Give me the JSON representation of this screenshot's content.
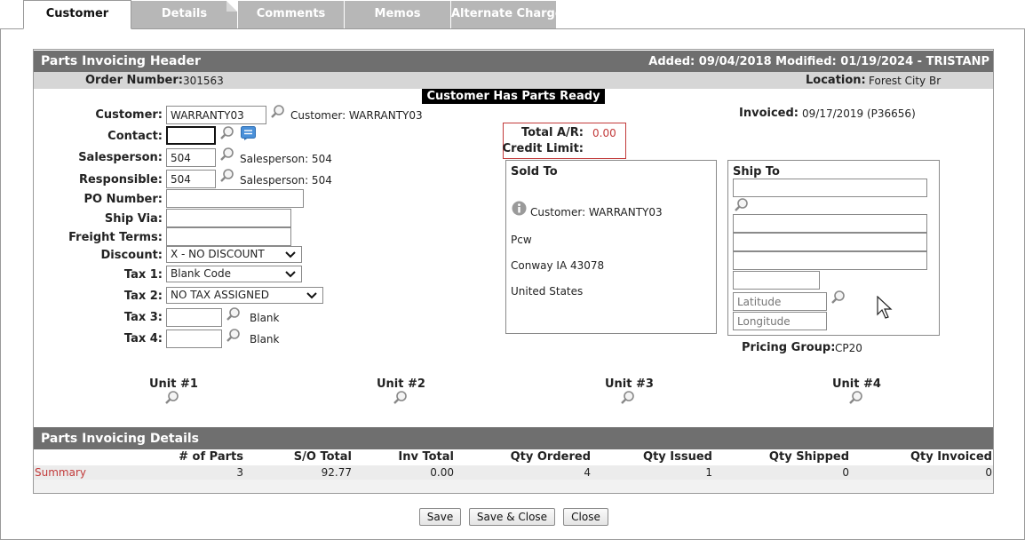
{
  "tabs": [
    "Customer",
    "Details",
    "Comments",
    "Memos",
    "Alternate Charge"
  ],
  "header": {
    "title": "Parts Invoicing Header",
    "added_modified": "Added: 09/04/2018 Modified: 01/19/2024 - TRISTANP",
    "order_number_label": "Order Number:",
    "order_number": "301563",
    "location_label": "Location:",
    "location": "Forest City Br",
    "banner": "Customer Has Parts Ready"
  },
  "form": {
    "customer_label": "Customer:",
    "customer_value": "WARRANTY03",
    "customer_desc": "Customer: WARRANTY03",
    "contact_label": "Contact:",
    "contact_value": "",
    "salesperson_label": "Salesperson:",
    "salesperson_value": "504",
    "salesperson_desc": "Salesperson: 504",
    "responsible_label": "Responsible:",
    "responsible_value": "504",
    "responsible_desc": "Salesperson: 504",
    "po_label": "PO Number:",
    "po_value": "",
    "shipvia_label": "Ship Via:",
    "shipvia_value": "",
    "freight_label": "Freight Terms:",
    "freight_value": "",
    "discount_label": "Discount:",
    "discount_value": "X - NO DISCOUNT",
    "tax1_label": "Tax 1:",
    "tax1_value": "Blank Code",
    "tax2_label": "Tax 2:",
    "tax2_value": "NO TAX ASSIGNED",
    "tax3_label": "Tax 3:",
    "tax3_value": "",
    "tax3_desc": "Blank",
    "tax4_label": "Tax 4:",
    "tax4_value": "",
    "tax4_desc": "Blank"
  },
  "ar": {
    "total_label": "Total A/R:",
    "total_value": "0.00",
    "credit_label": "Credit Limit:",
    "credit_value": ""
  },
  "invoiced": {
    "label": "Invoiced:",
    "value": "09/17/2019 (P36656)"
  },
  "sold_to": {
    "title": "Sold To",
    "customer": "Customer: WARRANTY03",
    "line1": "Pcw",
    "line2": "Conway IA 43078",
    "line3": "United States"
  },
  "ship_to": {
    "title": "Ship To",
    "latitude_placeholder": "Latitude",
    "longitude_placeholder": "Longitude"
  },
  "pricing": {
    "label": "Pricing Group:",
    "value": "CP20"
  },
  "units": [
    "Unit #1",
    "Unit #2",
    "Unit #3",
    "Unit #4"
  ],
  "details": {
    "title": "Parts Invoicing Details",
    "columns": [
      "# of Parts",
      "S/O Total",
      "Inv Total",
      "Qty Ordered",
      "Qty Issued",
      "Qty Shipped",
      "Qty Invoiced"
    ],
    "row_label": "Summary",
    "row": [
      "3",
      "92.77",
      "0.00",
      "4",
      "1",
      "0",
      "0"
    ]
  },
  "buttons": {
    "save": "Save",
    "save_close": "Save & Close",
    "close": "Close"
  },
  "colors": {
    "header_bar": "#6f6f6f",
    "accent_red": "#c23a3a",
    "tab_inactive": "#b7b7b7"
  },
  "icons": [
    "magnifier-icon",
    "notes-icon",
    "info-icon",
    "chevron-down-icon",
    "mouse-cursor-icon"
  ]
}
